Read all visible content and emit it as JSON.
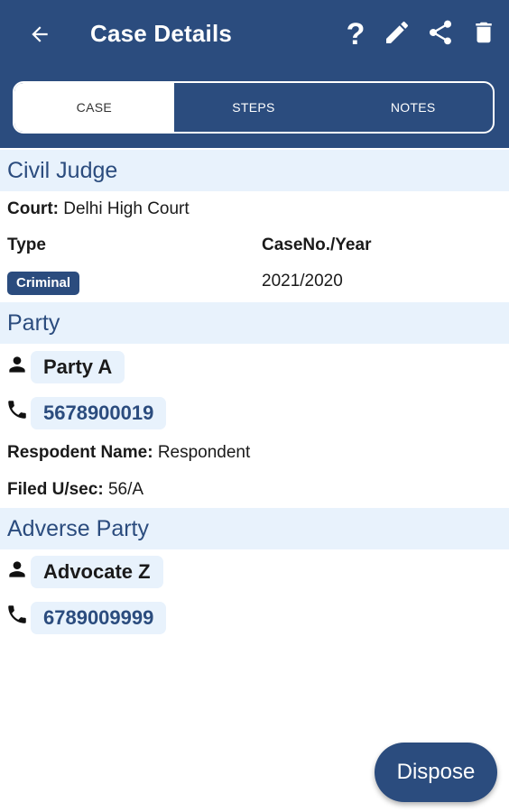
{
  "header": {
    "title": "Case Details",
    "help_icon_glyph": "?",
    "back_icon": "arrow-left-icon",
    "actions": [
      "help-icon",
      "pencil-icon",
      "share-icon",
      "trash-icon"
    ]
  },
  "tabs": [
    {
      "label": "CASE",
      "active": true
    },
    {
      "label": "STEPS",
      "active": false
    },
    {
      "label": "NOTES",
      "active": false
    }
  ],
  "case": {
    "section_title": "Civil Judge",
    "court_label": "Court:",
    "court_value": "Delhi High Court",
    "type_label": "Type",
    "caseno_label": "CaseNo./Year",
    "type_value": "Criminal",
    "caseno_value": "2021/2020"
  },
  "party": {
    "section_title": "Party",
    "name": "Party A",
    "phone": "5678900019",
    "respondent_label": "Respodent Name:",
    "respondent_value": "Respondent",
    "filed_label": "Filed U/sec:",
    "filed_value": "56/A"
  },
  "adverse": {
    "section_title": "Adverse Party",
    "name": "Advocate Z",
    "phone": "6789009999"
  },
  "fab": {
    "label": "Dispose"
  },
  "colors": {
    "primary": "#2b4c7e",
    "section_bg": "#e8f2fc",
    "white": "#ffffff"
  }
}
